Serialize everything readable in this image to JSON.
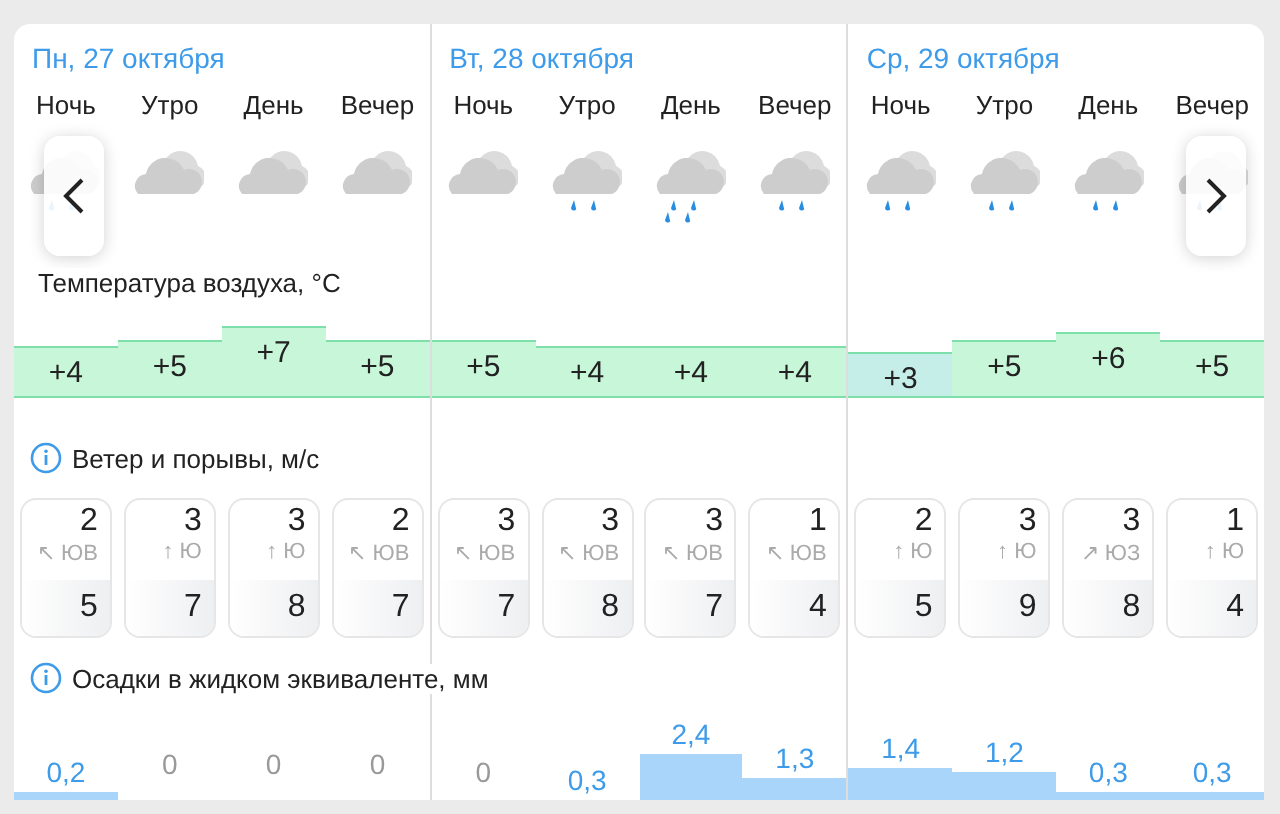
{
  "sections": {
    "temperature": "Температура воздуха, °C",
    "wind": "Ветер и порывы, м/с",
    "precipitation": "Осадки в жидком эквиваленте, мм"
  },
  "days": [
    {
      "date": "Пн, 27 октября",
      "periods": [
        {
          "label": "Ночь",
          "kind": "rain",
          "temperature": "+4",
          "wind": {
            "speed": "2",
            "arrow": "↖",
            "direction": "ЮВ",
            "gust": "5"
          },
          "precipitation": "0,2"
        },
        {
          "label": "Утро",
          "kind": "cloudy",
          "temperature": "+5",
          "wind": {
            "speed": "3",
            "arrow": "↑",
            "direction": "Ю",
            "gust": "7"
          },
          "precipitation": "0"
        },
        {
          "label": "День",
          "kind": "cloudy",
          "temperature": "+7",
          "wind": {
            "speed": "3",
            "arrow": "↑",
            "direction": "Ю",
            "gust": "8"
          },
          "precipitation": "0"
        },
        {
          "label": "Вечер",
          "kind": "cloudy",
          "temperature": "+5",
          "wind": {
            "speed": "2",
            "arrow": "↖",
            "direction": "ЮВ",
            "gust": "7"
          },
          "precipitation": "0"
        }
      ]
    },
    {
      "date": "Вт, 28 октября",
      "periods": [
        {
          "label": "Ночь",
          "kind": "cloudy",
          "temperature": "+5",
          "wind": {
            "speed": "3",
            "arrow": "↖",
            "direction": "ЮВ",
            "gust": "7"
          },
          "precipitation": "0"
        },
        {
          "label": "Утро",
          "kind": "rain",
          "temperature": "+4",
          "wind": {
            "speed": "3",
            "arrow": "↖",
            "direction": "ЮВ",
            "gust": "8"
          },
          "precipitation": "0,3"
        },
        {
          "label": "День",
          "kind": "heavy_rain",
          "temperature": "+4",
          "wind": {
            "speed": "3",
            "arrow": "↖",
            "direction": "ЮВ",
            "gust": "7"
          },
          "precipitation": "2,4"
        },
        {
          "label": "Вечер",
          "kind": "rain",
          "temperature": "+4",
          "wind": {
            "speed": "1",
            "arrow": "↖",
            "direction": "ЮВ",
            "gust": "4"
          },
          "precipitation": "1,3"
        }
      ]
    },
    {
      "date": "Ср, 29 октября",
      "periods": [
        {
          "label": "Ночь",
          "kind": "rain",
          "temperature": "+3",
          "wind": {
            "speed": "2",
            "arrow": "↑",
            "direction": "Ю",
            "gust": "5"
          },
          "precipitation": "1,4"
        },
        {
          "label": "Утро",
          "kind": "rain",
          "temperature": "+5",
          "wind": {
            "speed": "3",
            "arrow": "↑",
            "direction": "Ю",
            "gust": "9"
          },
          "precipitation": "1,2"
        },
        {
          "label": "День",
          "kind": "rain",
          "temperature": "+6",
          "wind": {
            "speed": "3",
            "arrow": "↗",
            "direction": "ЮЗ",
            "gust": "8"
          },
          "precipitation": "0,3"
        },
        {
          "label": "Вечер",
          "kind": "rain",
          "temperature": "+5",
          "wind": {
            "speed": "1",
            "arrow": "↑",
            "direction": "Ю",
            "gust": "4"
          },
          "precipitation": "0,3"
        }
      ]
    }
  ]
}
